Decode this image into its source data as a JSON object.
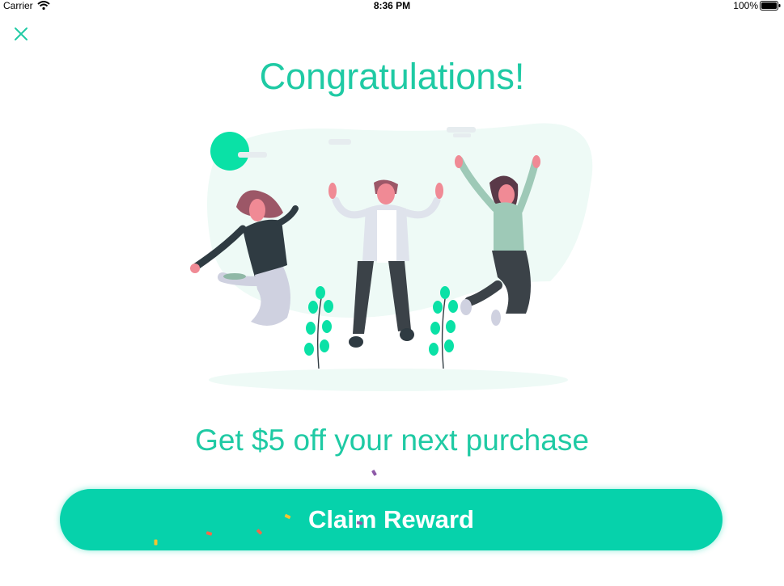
{
  "status_bar": {
    "carrier": "Carrier",
    "time": "8:36 PM",
    "battery": "100%"
  },
  "dialog": {
    "close_icon": "close-x-icon",
    "title": "Congratulations!",
    "subtitle": "Get $5 off your next purchase",
    "claim_label": "Claim Reward"
  },
  "colors": {
    "accent": "#1fcaa4",
    "button": "#06d2ab",
    "background": "#ffffff"
  }
}
